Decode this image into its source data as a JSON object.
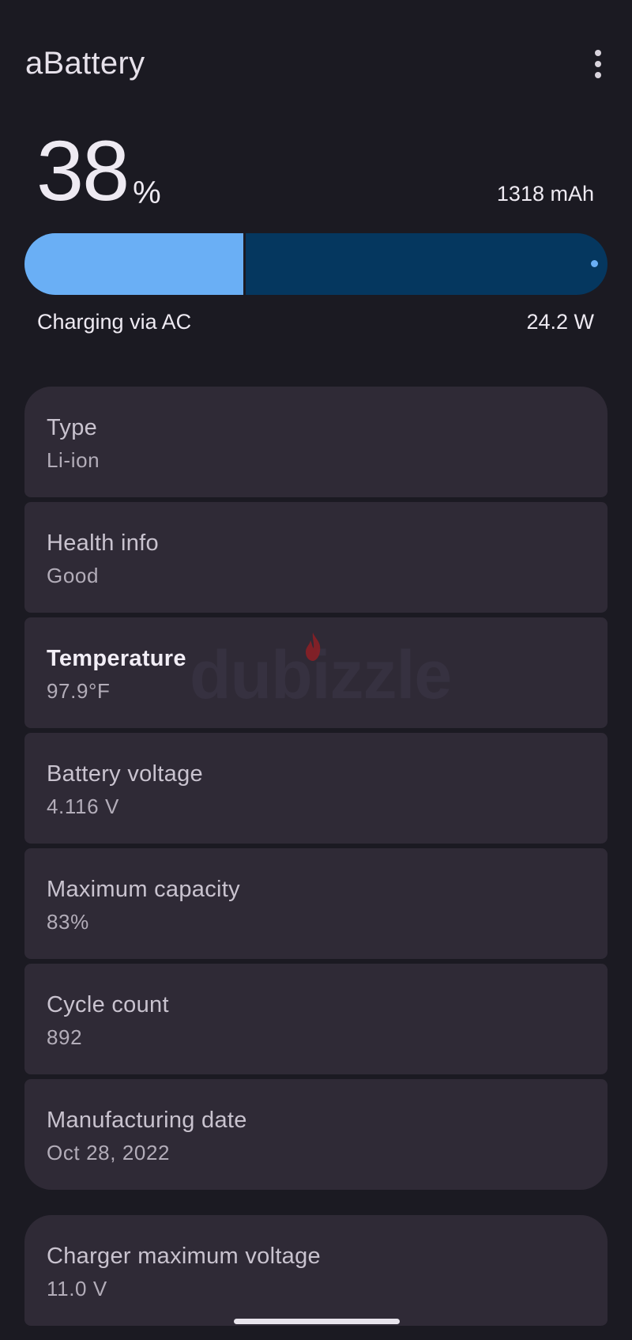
{
  "app": {
    "title": "aBattery",
    "menu_icon": "more-vert-icon"
  },
  "battery": {
    "percent": "38",
    "percent_sign": "%",
    "level_fraction": 0.38,
    "capacity": "1318 mAh",
    "charging_status": "Charging via AC",
    "charging_power": "24.2 W"
  },
  "colors": {
    "background": "#1b1a22",
    "bar_fill": "#6aaff5",
    "bar_track": "#05375f",
    "card": "#2f2a36"
  },
  "info_cards": [
    {
      "label": "Type",
      "value": "Li-ion"
    },
    {
      "label": "Health info",
      "value": "Good"
    },
    {
      "label": "Temperature",
      "value": "97.9°F"
    },
    {
      "label": "Battery voltage",
      "value": "4.116 V"
    },
    {
      "label": "Maximum capacity",
      "value": "83%"
    },
    {
      "label": "Cycle count",
      "value": "892"
    },
    {
      "label": "Manufacturing date",
      "value": "Oct 28, 2022"
    }
  ],
  "charger_cards": [
    {
      "label": "Charger maximum voltage",
      "value": "11.0 V"
    }
  ],
  "watermark": {
    "text": "dubizzle"
  }
}
